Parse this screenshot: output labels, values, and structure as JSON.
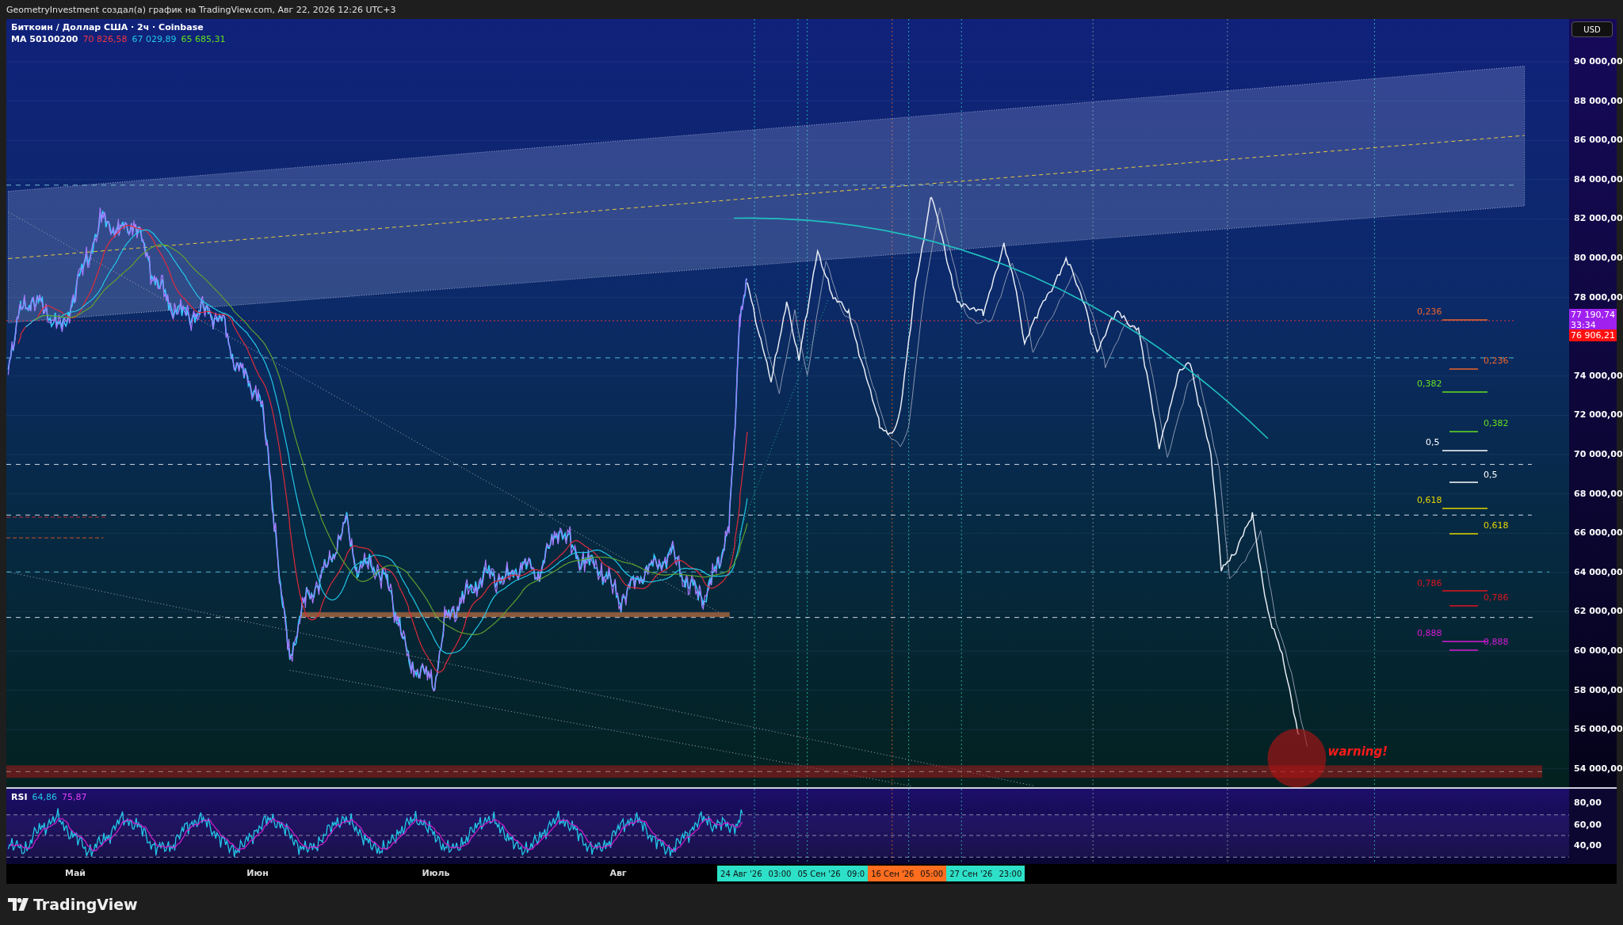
{
  "header": {
    "title": "GeometryInvestment создал(а) график на TradingView.com, Авг 22, 2026 12:26 UTC+3"
  },
  "legend": {
    "symbol": "Биткоин / Доллар США · 2ч · Coinbase",
    "indicator": "MA 50100200",
    "values": [
      {
        "text": "70 826,58",
        "color": "#f23645"
      },
      {
        "text": "67 029,89",
        "color": "#22c7e8"
      },
      {
        "text": "65 685,31",
        "color": "#5ee01e"
      }
    ]
  },
  "currency": "USD",
  "price_axis": [
    "90 000,00",
    "88 000,00",
    "86 000,00",
    "84 000,00",
    "82 000,00",
    "80 000,00",
    "78 000,00",
    "74 000,00",
    "72 000,00",
    "70 000,00",
    "68 000,00",
    "66 000,00",
    "64 000,00",
    "62 000,00",
    "60 000,00",
    "58 000,00",
    "56 000,00",
    "54 000,00"
  ],
  "price_tags": [
    {
      "text": "77 190,74",
      "subtext": "33:34",
      "color": "#a020f0"
    },
    {
      "text": "76 906,21",
      "color": "#ff1010"
    }
  ],
  "fib_labels": [
    {
      "text": "0,236",
      "color": "#f0642a"
    },
    {
      "text": "0,236",
      "color": "#f0642a"
    },
    {
      "text": "0,382",
      "color": "#66e020"
    },
    {
      "text": "0,382",
      "color": "#66e020"
    },
    {
      "text": "0,5",
      "color": "#ffffff"
    },
    {
      "text": "0,5",
      "color": "#ffffff"
    },
    {
      "text": "0,618",
      "color": "#e5d400"
    },
    {
      "text": "0,618",
      "color": "#e5d400"
    },
    {
      "text": "0,786",
      "color": "#e0141e"
    },
    {
      "text": "0,786",
      "color": "#e0141e"
    },
    {
      "text": "0,888",
      "color": "#d81bd8"
    },
    {
      "text": "0,888",
      "color": "#d81bd8"
    }
  ],
  "annotation": {
    "text": "warning!"
  },
  "rsi": {
    "label": "RSI",
    "values": [
      {
        "text": "64,86",
        "color": "#22c7e8"
      },
      {
        "text": "75,87",
        "color": "#e040fb"
      }
    ],
    "axis": [
      "80,00",
      "60,00",
      "40,00"
    ]
  },
  "time_axis": {
    "months": [
      "Май",
      "Июн",
      "Июль",
      "Авг"
    ],
    "markers": [
      {
        "color": "#2de0c8",
        "labels": [
          "24 Авг '26",
          "03:00",
          "05 Сен '26",
          "09:0"
        ]
      },
      {
        "color": "#ff6d1f",
        "labels": [
          "16 Сен '26",
          "05:00"
        ]
      },
      {
        "color": "#2de0c8",
        "labels": [
          "27 Сен '26",
          "23:00"
        ]
      }
    ]
  },
  "brand": "TradingView"
}
